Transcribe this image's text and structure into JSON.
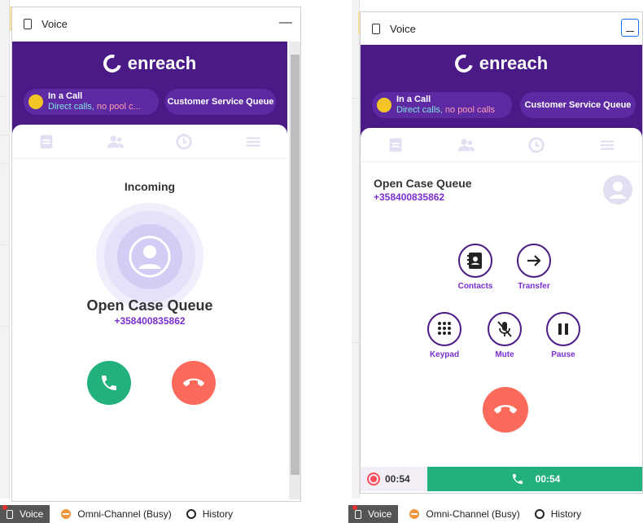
{
  "left_window": {
    "title": "Voice",
    "minimize_label": "—",
    "brand": "enreach",
    "status": {
      "title": "In a Call",
      "line_prefix": "Direct calls,",
      "line_rest": " no pool c..."
    },
    "queue_pill": "Customer Service Queue",
    "heading": "Incoming",
    "contact_name": "Open Case Queue",
    "contact_number": "+358400835862"
  },
  "right_window": {
    "title": "Voice",
    "brand": "enreach",
    "status": {
      "title": "In a Call",
      "line_prefix": "Direct calls,",
      "line_rest": " no pool calls"
    },
    "queue_pill": "Customer Service Queue",
    "contact_name": "Open Case Queue",
    "contact_number": "+358400835862",
    "controls": [
      {
        "label": "Contacts",
        "icon": "contacts-icon"
      },
      {
        "label": "Transfer",
        "icon": "arrow-right-icon"
      },
      {
        "label": "Keypad",
        "icon": "keypad-icon"
      },
      {
        "label": "Mute",
        "icon": "mic-off-icon"
      },
      {
        "label": "Pause",
        "icon": "pause-icon"
      }
    ],
    "record_timer": "00:54",
    "call_timer": "00:54"
  },
  "taskbar": {
    "voice": "Voice",
    "omni": "Omni-Channel (Busy)",
    "history": "History"
  },
  "colors": {
    "header_purple": "#4a1a86",
    "accent_purple": "#7a2fd3",
    "answer_green": "#22b07d",
    "hangup_red": "#fb6a5a",
    "status_yellow": "#f2c525"
  }
}
